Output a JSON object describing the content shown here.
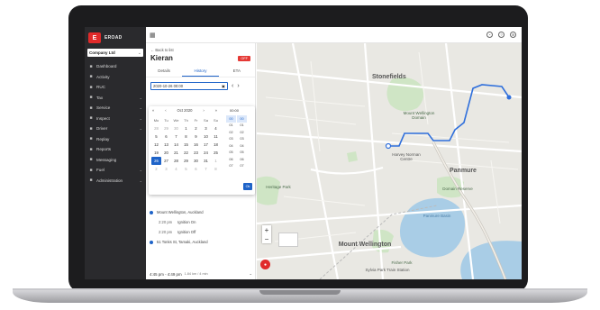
{
  "brand": {
    "logo_letter": "E",
    "name": "EROAD"
  },
  "company": {
    "value": "Company Ltd"
  },
  "sidebar": {
    "items": [
      {
        "label": "Dashboard",
        "icon": "dashboard-icon",
        "chevron": false
      },
      {
        "label": "Activity",
        "icon": "activity-icon",
        "chevron": false
      },
      {
        "label": "RUC",
        "icon": "ruc-icon",
        "chevron": false
      },
      {
        "label": "Tax",
        "icon": "tax-icon",
        "chevron": true
      },
      {
        "label": "Service",
        "icon": "service-icon",
        "chevron": true
      },
      {
        "label": "Inspect",
        "icon": "inspect-icon",
        "chevron": true
      },
      {
        "label": "Driver",
        "icon": "driver-icon",
        "chevron": true
      },
      {
        "label": "Replay",
        "icon": "replay-icon",
        "chevron": false
      },
      {
        "label": "Reports",
        "icon": "reports-icon",
        "chevron": false
      },
      {
        "label": "Messaging",
        "icon": "messaging-icon",
        "chevron": false
      },
      {
        "label": "Fuel",
        "icon": "fuel-icon",
        "chevron": true
      },
      {
        "label": "Administration",
        "icon": "admin-icon",
        "chevron": true
      }
    ]
  },
  "panel": {
    "back_label": "Back to list",
    "vehicle_name": "Kieran",
    "status_badge": "OFF",
    "tabs": [
      "Details",
      "History",
      "ETA"
    ],
    "date_value": "2020-10-26 00:00",
    "calendar": {
      "month_label": "Oct",
      "year_label": "2020",
      "weekdays": [
        "Mo",
        "Tu",
        "We",
        "Th",
        "Fr",
        "Sa",
        "Su"
      ],
      "weeks": [
        [
          "28",
          "29",
          "30",
          "1",
          "2",
          "3",
          "4"
        ],
        [
          "5",
          "6",
          "7",
          "8",
          "9",
          "10",
          "11"
        ],
        [
          "12",
          "13",
          "14",
          "15",
          "16",
          "17",
          "18"
        ],
        [
          "19",
          "20",
          "21",
          "22",
          "23",
          "24",
          "25"
        ],
        [
          "26",
          "27",
          "28",
          "29",
          "30",
          "31",
          "1"
        ],
        [
          "2",
          "3",
          "4",
          "5",
          "6",
          "7",
          "8"
        ]
      ],
      "selected_day": "26",
      "time_label": "00:00",
      "hours": [
        "00",
        "01",
        "02",
        "03",
        "04",
        "05",
        "06",
        "07"
      ],
      "minutes": [
        "00",
        "01",
        "02",
        "03",
        "04",
        "05",
        "06",
        "07"
      ],
      "ok_label": "Ok"
    },
    "events": [
      {
        "type": "location",
        "text": "Mount Wellington, Auckland"
      },
      {
        "type": "ignition",
        "time": "2:20 pm",
        "text": "Ignition On"
      },
      {
        "type": "ignition",
        "time": "2:20 pm",
        "text": "Ignition Off"
      },
      {
        "type": "location",
        "text": "51 Tonks St, Tamaki, Auckland"
      }
    ],
    "trip_summary": "4:45 pm - 4:49 pm",
    "trip_distance": "1.84 km / 4 min"
  },
  "map": {
    "labels": {
      "stonefields": "Stonefields",
      "mount_wellington_domain": "Mount Wellington Domain",
      "harvey_norman": "Harvey Norman Centre",
      "panmure": "Panmure",
      "heritage_park": "Heritage Park",
      "domain_reserve": "Domain Reserve",
      "panmure_basin": "Panmure Basin",
      "mount_wellington": "Mount Wellington",
      "fisher_park": "Fisher Park",
      "sylvia_park": "Sylvia Park Train Station"
    },
    "route_color": "#2f6fdc"
  },
  "colors": {
    "accent": "#1e63c8",
    "brand": "#e02a2a"
  }
}
